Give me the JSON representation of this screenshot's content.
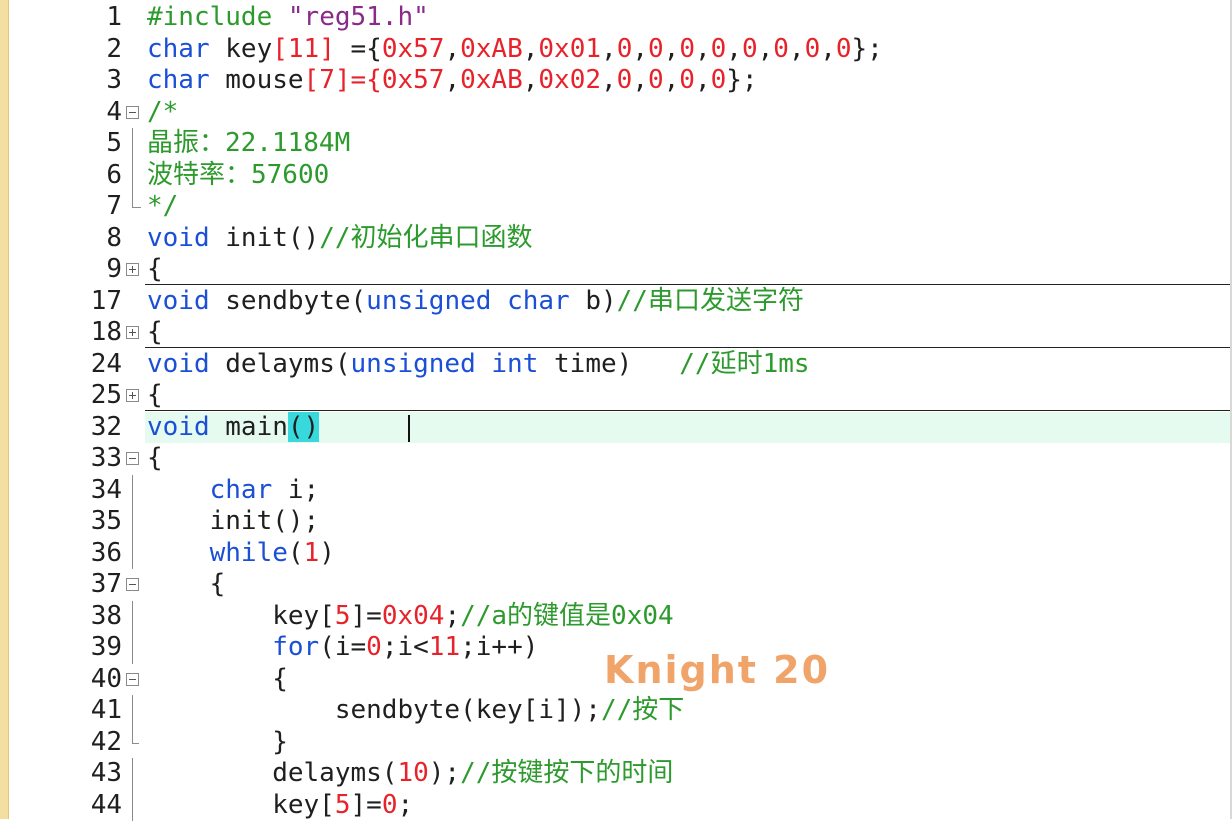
{
  "editor": {
    "watermark": "Knight 20",
    "colors": {
      "keyword": "#1a4fd6",
      "number": "#e8222a",
      "comment": "#2d9a2d",
      "current_line": "#e6fbef",
      "brace_match": "#38d9dd"
    },
    "lines": [
      {
        "num": "1",
        "fold": "none"
      },
      {
        "num": "2",
        "fold": "none"
      },
      {
        "num": "3",
        "fold": "none"
      },
      {
        "num": "4",
        "fold": "open"
      },
      {
        "num": "5",
        "fold": "vline"
      },
      {
        "num": "6",
        "fold": "vline"
      },
      {
        "num": "7",
        "fold": "end"
      },
      {
        "num": "8",
        "fold": "none"
      },
      {
        "num": "9",
        "fold": "collapsed"
      },
      {
        "num": "17",
        "fold": "none"
      },
      {
        "num": "18",
        "fold": "collapsed"
      },
      {
        "num": "24",
        "fold": "none"
      },
      {
        "num": "25",
        "fold": "collapsed"
      },
      {
        "num": "32",
        "fold": "none"
      },
      {
        "num": "33",
        "fold": "open"
      },
      {
        "num": "34",
        "fold": "none"
      },
      {
        "num": "35",
        "fold": "none"
      },
      {
        "num": "36",
        "fold": "none"
      },
      {
        "num": "37",
        "fold": "open"
      },
      {
        "num": "38",
        "fold": "none"
      },
      {
        "num": "39",
        "fold": "none"
      },
      {
        "num": "40",
        "fold": "open"
      },
      {
        "num": "41",
        "fold": "none"
      },
      {
        "num": "42",
        "fold": "tick"
      },
      {
        "num": "43",
        "fold": "none"
      },
      {
        "num": "44",
        "fold": "none"
      }
    ],
    "code": {
      "l1": [
        "#include ",
        "\"reg51.h\""
      ],
      "l2": [
        "char",
        " key",
        "[",
        "11",
        "]",
        " ={",
        "0x57",
        ",",
        "0xAB",
        ",",
        "0x01",
        ",",
        "0",
        ",",
        "0",
        ",",
        "0",
        ",",
        "0",
        ",",
        "0",
        ",",
        "0",
        ",",
        "0",
        ",",
        "0",
        "};"
      ],
      "l3": [
        "char",
        " mouse",
        "[",
        "7",
        "]={",
        "0x57",
        ",",
        "0xAB",
        ",",
        "0x02",
        ",",
        "0",
        ",",
        "0",
        ",",
        "0",
        ",",
        "0",
        "};"
      ],
      "l4": [
        "/*"
      ],
      "l5": [
        "晶振：22.1184M"
      ],
      "l6": [
        "波特率：57600"
      ],
      "l7": [
        "*/"
      ],
      "l8": [
        "void",
        " init()",
        "//初始化串口函数"
      ],
      "l9": [
        "{"
      ],
      "l17": [
        "void",
        " sendbyte(",
        "unsigned",
        " ",
        "char",
        " b)",
        "//串口发送字符"
      ],
      "l18": [
        "{"
      ],
      "l24": [
        "void",
        " delayms(",
        "unsigned",
        " ",
        "int",
        " time)   ",
        "//延时1ms"
      ],
      "l25": [
        "{"
      ],
      "l32": [
        "void",
        " main",
        "()"
      ],
      "l33": [
        "{"
      ],
      "l34": [
        "    ",
        "char",
        " i;"
      ],
      "l35": [
        "    init();"
      ],
      "l36": [
        "    ",
        "while",
        "(",
        "1",
        ")"
      ],
      "l37": [
        "    {"
      ],
      "l38": [
        "        key[",
        "5",
        "]=",
        "0x04",
        ";",
        "//a的键值是0x04"
      ],
      "l39": [
        "        ",
        "for",
        "(i=",
        "0",
        ";i<",
        "11",
        ";i++)"
      ],
      "l40": [
        "        {"
      ],
      "l41": [
        "            sendbyte(key[i]);",
        "//按下"
      ],
      "l42": [
        "        }"
      ],
      "l43": [
        "        delayms(",
        "10",
        ");",
        "//按键按下的时间"
      ],
      "l44": [
        "        key[",
        "5",
        "]=",
        "0",
        ";"
      ]
    }
  }
}
